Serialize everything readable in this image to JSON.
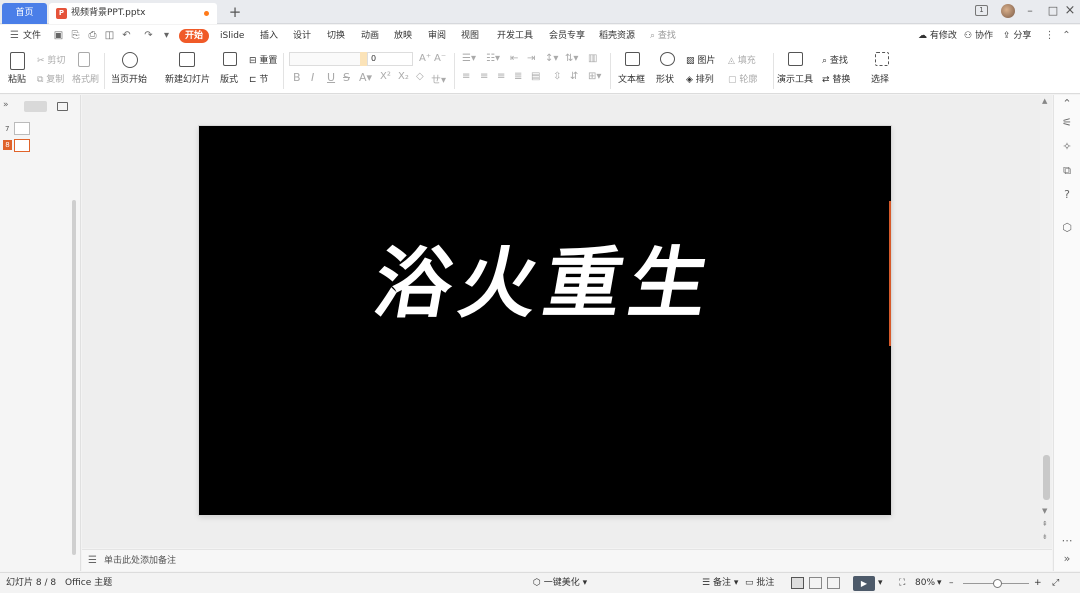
{
  "tabs": {
    "home": "首页",
    "document": "视频背景PPT.pptx",
    "add": "+"
  },
  "window": {
    "badge": "1",
    "minimize": "–",
    "maximize": "□",
    "close": "×"
  },
  "menu": {
    "file": "文件",
    "items": [
      "开始",
      "iSlide",
      "插入",
      "设计",
      "切换",
      "动画",
      "放映",
      "审阅",
      "视图",
      "开发工具",
      "会员专享",
      "稻壳资源"
    ],
    "search_placeholder": "查找",
    "actions": [
      "有修改",
      "协作",
      "分享"
    ]
  },
  "toolbar": {
    "paste": "粘贴",
    "cut": "剪切",
    "copy": "复制",
    "format_painter": "格式刷",
    "from_current": "当页开始",
    "new_slide": "新建幻灯片",
    "layout": "版式",
    "reset": "重置",
    "section": "节",
    "font_size": "0",
    "text_box": "文本框",
    "shapes": "形状",
    "picture": "图片",
    "fill": "填充",
    "arrange": "排列",
    "outline": "轮廓",
    "presentation_tools": "演示工具",
    "find": "查找",
    "replace": "替换",
    "select": "选择",
    "format_glyphs": [
      "B",
      "I",
      "U",
      "S"
    ]
  },
  "left_panel": {
    "expand": "»",
    "slides": [
      {
        "number": "7",
        "selected": false
      },
      {
        "number": "8",
        "selected": true
      }
    ]
  },
  "slide": {
    "title": "浴火重生"
  },
  "notes": {
    "placeholder": "单击此处添加备注"
  },
  "status": {
    "slide_counter": "幻灯片 8 / 8",
    "theme": "Office 主题",
    "beautify": "一键美化",
    "notes_btn": "备注",
    "comments_btn": "批注",
    "zoom": "80%",
    "zoom_minus": "–",
    "zoom_plus": "+"
  }
}
